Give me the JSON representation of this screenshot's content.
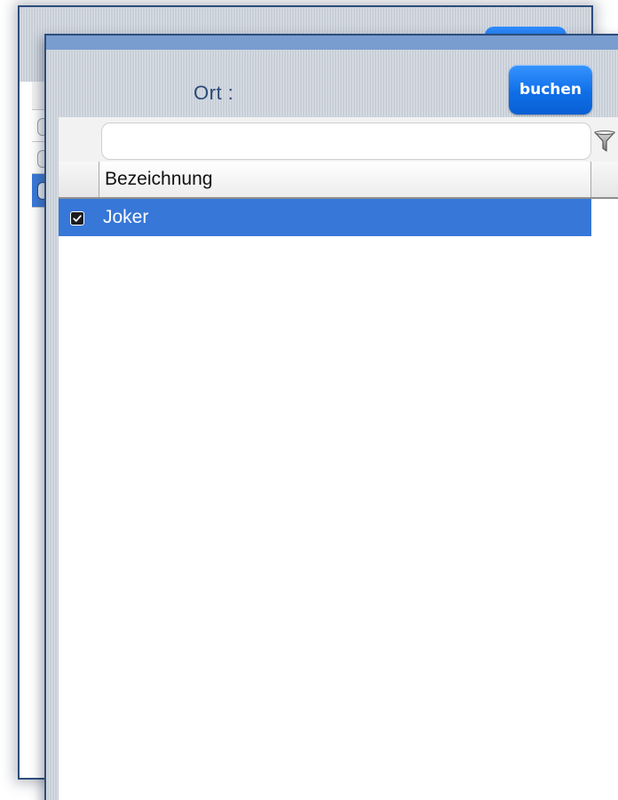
{
  "dialog": {
    "location_label": "Ort :",
    "book_button_label": "buchen"
  },
  "grid": {
    "filter_value": "",
    "filter_placeholder": "",
    "columns": [
      "Bezeichnung"
    ],
    "rows": [
      {
        "label": "Joker",
        "checked": true,
        "selected": true
      }
    ]
  },
  "icons": {
    "filter": "funnel-filter-icon",
    "checkbox": "checkmark-icon"
  },
  "colors": {
    "accent_button": "#0f6fe8",
    "selection_row": "#3777d8",
    "window_border": "#2d4c7c",
    "label_text": "#2c4a78"
  }
}
